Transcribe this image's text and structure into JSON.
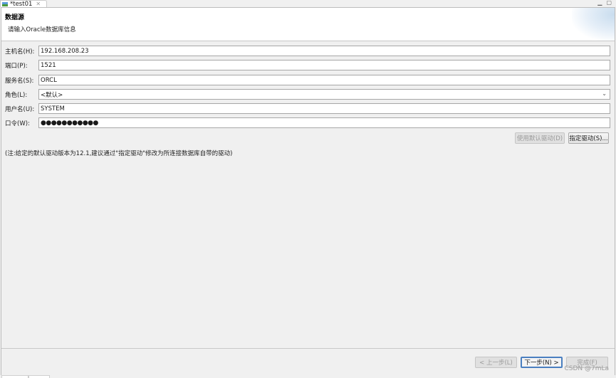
{
  "editor_tab": {
    "title": "*test01"
  },
  "wizard": {
    "title": "数据源",
    "description": "请输入Oracle数据库信息"
  },
  "form": {
    "host": {
      "label": "主机名(H):",
      "value": "192.168.208.23"
    },
    "port": {
      "label": "端口(P):",
      "value": "1521"
    },
    "service": {
      "label": "服务名(S):",
      "value": "ORCL"
    },
    "role": {
      "label": "角色(L):",
      "value": "<默认>"
    },
    "user": {
      "label": "用户名(U):",
      "value": "SYSTEM"
    },
    "password": {
      "label": "口令(W):",
      "value": "●●●●●●●●●●●"
    }
  },
  "driver_buttons": {
    "use_default": "使用默认驱动(D)",
    "specify": "指定驱动(S)..."
  },
  "note": "(注:给定的默认驱动版本为12.1,建议通过\"指定驱动\"修改为所连接数据库自带的驱动)",
  "nav_buttons": {
    "back": "< 上一步(L)",
    "next": "下一步(N) >",
    "finish": "完成(F)"
  },
  "watermark": "CSDN @7mLa",
  "colors": {
    "primary_border": "#4a7fc0",
    "background": "#f0f0f0"
  }
}
